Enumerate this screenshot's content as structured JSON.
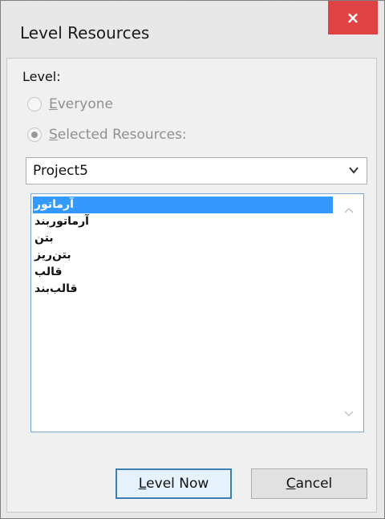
{
  "dialog": {
    "title": "Level Resources",
    "close_label": "×"
  },
  "level": {
    "label": "Level:",
    "everyone": {
      "mnemonic": "E",
      "rest": "veryone",
      "selected": false,
      "enabled": false
    },
    "selected_resources": {
      "mnemonic": "S",
      "rest": "elected Resources:",
      "selected": true,
      "enabled": false
    }
  },
  "project_combo": {
    "value": "Project5"
  },
  "resource_list": {
    "items": [
      "آرماتور",
      "آرماتوربند",
      "بتن",
      "بتن‌ریز",
      "قالب",
      "قالب‌بند"
    ],
    "selected_index": 0
  },
  "buttons": {
    "level_now": {
      "mnemonic": "L",
      "rest": "evel Now"
    },
    "cancel": {
      "mnemonic": "C",
      "rest": "ancel"
    }
  },
  "colors": {
    "close_bg": "#e04343",
    "selection_bg": "#3399ff",
    "default_button_border": "#3c7fb1"
  }
}
